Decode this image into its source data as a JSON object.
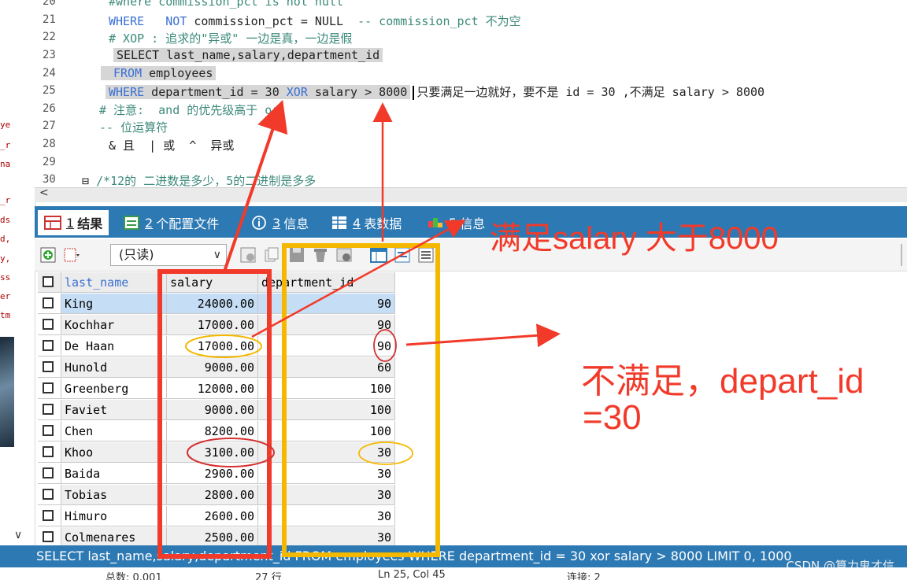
{
  "left_fragments": [
    "ye",
    "_r",
    "na",
    "_r",
    "ds",
    "d,",
    "y,",
    "ss",
    "er",
    "tm"
  ],
  "left_chevron": "∨",
  "editor": {
    "lines": [
      {
        "no": "20",
        "text": "#where commission_pct is not null"
      },
      {
        "no": "21",
        "kw1": "WHERE",
        "kw2": "NOT",
        "mid": " commission_pct = NULL  ",
        "comment": "-- commission_pct 不为空"
      },
      {
        "no": "22",
        "text": "# XOP : 追求的\"异或\" 一边是真，一边是假"
      },
      {
        "no": "23",
        "text": "SELECT last_name,salary,department_id"
      },
      {
        "no": "24",
        "kw": "FROM",
        "rest": " employees"
      },
      {
        "no": "25",
        "kw": "WHERE",
        "mid": " department_id = 30 ",
        "kw2": "XOR",
        "tail": " salary > 8000",
        "note": "只要满足一边就好，要不是 id = 30 ,不满足 salary > 8000"
      },
      {
        "no": "26",
        "text": "# 注意:  and 的优先级高于 or"
      },
      {
        "no": "27",
        "text": "-- 位运算符"
      },
      {
        "no": "28",
        "text": "& 且  | 或  ^  异或"
      },
      {
        "no": "29",
        "text": ""
      },
      {
        "no": "30",
        "text": "/*12的 二进数是多少，5的二进制是多多"
      }
    ],
    "fold_marker": "⊟",
    "scroll_left": "<"
  },
  "tabs": [
    {
      "num": "1",
      "label": "结果",
      "active": true
    },
    {
      "num": "2",
      "label": "个配置文件"
    },
    {
      "num": "3",
      "label": "信息"
    },
    {
      "num": "4",
      "label": "表数据"
    },
    {
      "num": "5",
      "label": "信息"
    }
  ],
  "toolbar": {
    "readonly_label": "(只读)",
    "arrow": "∨"
  },
  "grid": {
    "headers": [
      "last_name",
      "salary",
      "department_id"
    ],
    "rows": [
      [
        "King",
        "24000.00",
        "90"
      ],
      [
        "Kochhar",
        "17000.00",
        "90"
      ],
      [
        "De Haan",
        "17000.00",
        "90"
      ],
      [
        "Hunold",
        "9000.00",
        "60"
      ],
      [
        "Greenberg",
        "12000.00",
        "100"
      ],
      [
        "Faviet",
        "9000.00",
        "100"
      ],
      [
        "Chen",
        "8200.00",
        "100"
      ],
      [
        "Khoo",
        "3100.00",
        "30"
      ],
      [
        "Baida",
        "2900.00",
        "30"
      ],
      [
        "Tobias",
        "2800.00",
        "30"
      ],
      [
        "Himuro",
        "2600.00",
        "30"
      ],
      [
        "Colmenares",
        "2500.00",
        "30"
      ]
    ]
  },
  "statusbar": {
    "sql": "SELECT last_name,salary,department_id FROM employees WHERE department_id = 30 xor salary > 8000 LIMIT 0, 1000"
  },
  "watermark": "CSDN @算力鬼才信",
  "bottom_strip": [
    "总数: 0.001",
    "27 行",
    "Ln 25, Col 45",
    "连接: 2"
  ],
  "annotations": {
    "top": "满足salary 大于8000",
    "right_line1": "不满足，depart_id",
    "right_line2": "=30"
  },
  "colors": {
    "accent": "#2d79b3",
    "annotation_red": "#f23a2a",
    "annotation_yellow": "#f5b800",
    "keyword": "#3a6fd4"
  }
}
